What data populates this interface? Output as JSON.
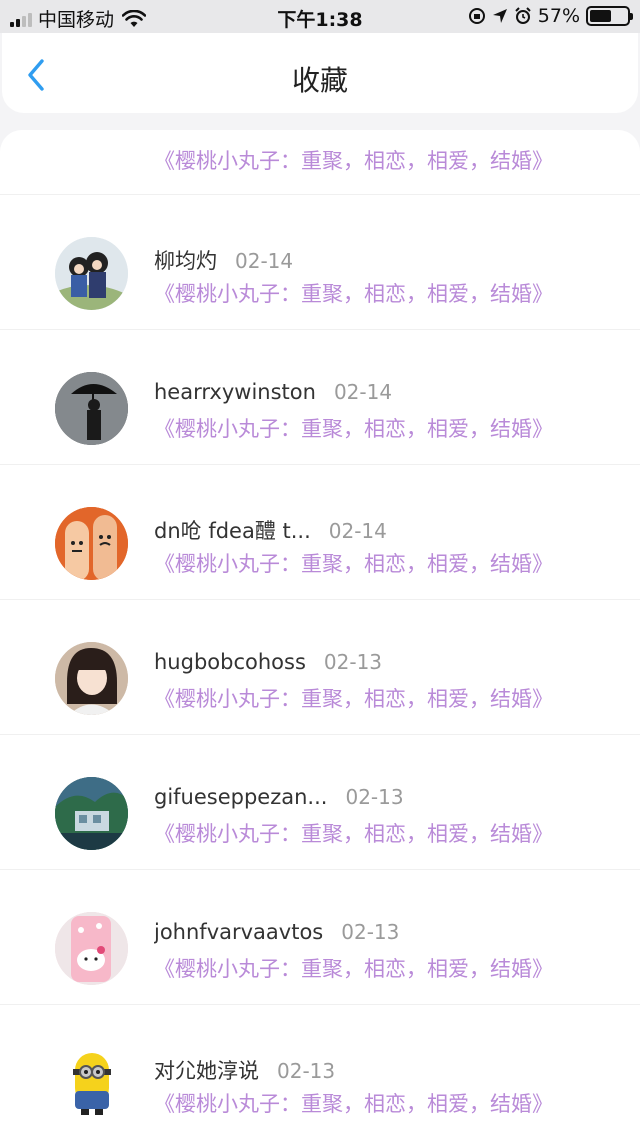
{
  "status_bar": {
    "carrier": "中国移动",
    "time": "下午1:38",
    "battery_percent": "57%",
    "battery_level": 0.57
  },
  "header": {
    "title": "收藏",
    "back_icon": "chevron-left-icon"
  },
  "colors": {
    "accent": "#2f9df0",
    "subtitle": "#b98ad8"
  },
  "favorites": [
    {
      "name": "",
      "date": "",
      "subtitle": "《樱桃小丸子：重聚，相恋，相爱，结婚》"
    },
    {
      "name": "柳均灼",
      "date": "02-14",
      "subtitle": "《樱桃小丸子：重聚，相恋，相爱，结婚》"
    },
    {
      "name": "hearrxywinston",
      "date": "02-14",
      "subtitle": "《樱桃小丸子：重聚，相恋，相爱，结婚》"
    },
    {
      "name": "dn呛 fdea醴 t...",
      "date": "02-14",
      "subtitle": "《樱桃小丸子：重聚，相恋，相爱，结婚》"
    },
    {
      "name": "hugbobcohoss",
      "date": "02-13",
      "subtitle": "《樱桃小丸子：重聚，相恋，相爱，结婚》"
    },
    {
      "name": "gifueseppezan...",
      "date": "02-13",
      "subtitle": "《樱桃小丸子：重聚，相恋，相爱，结婚》"
    },
    {
      "name": "johnfvarvaavtos",
      "date": "02-13",
      "subtitle": "《樱桃小丸子：重聚，相恋，相爱，结婚》"
    },
    {
      "name": "对尣她淳说",
      "date": "02-13",
      "subtitle": "《樱桃小丸子：重聚，相恋，相爱，结婚》"
    }
  ]
}
